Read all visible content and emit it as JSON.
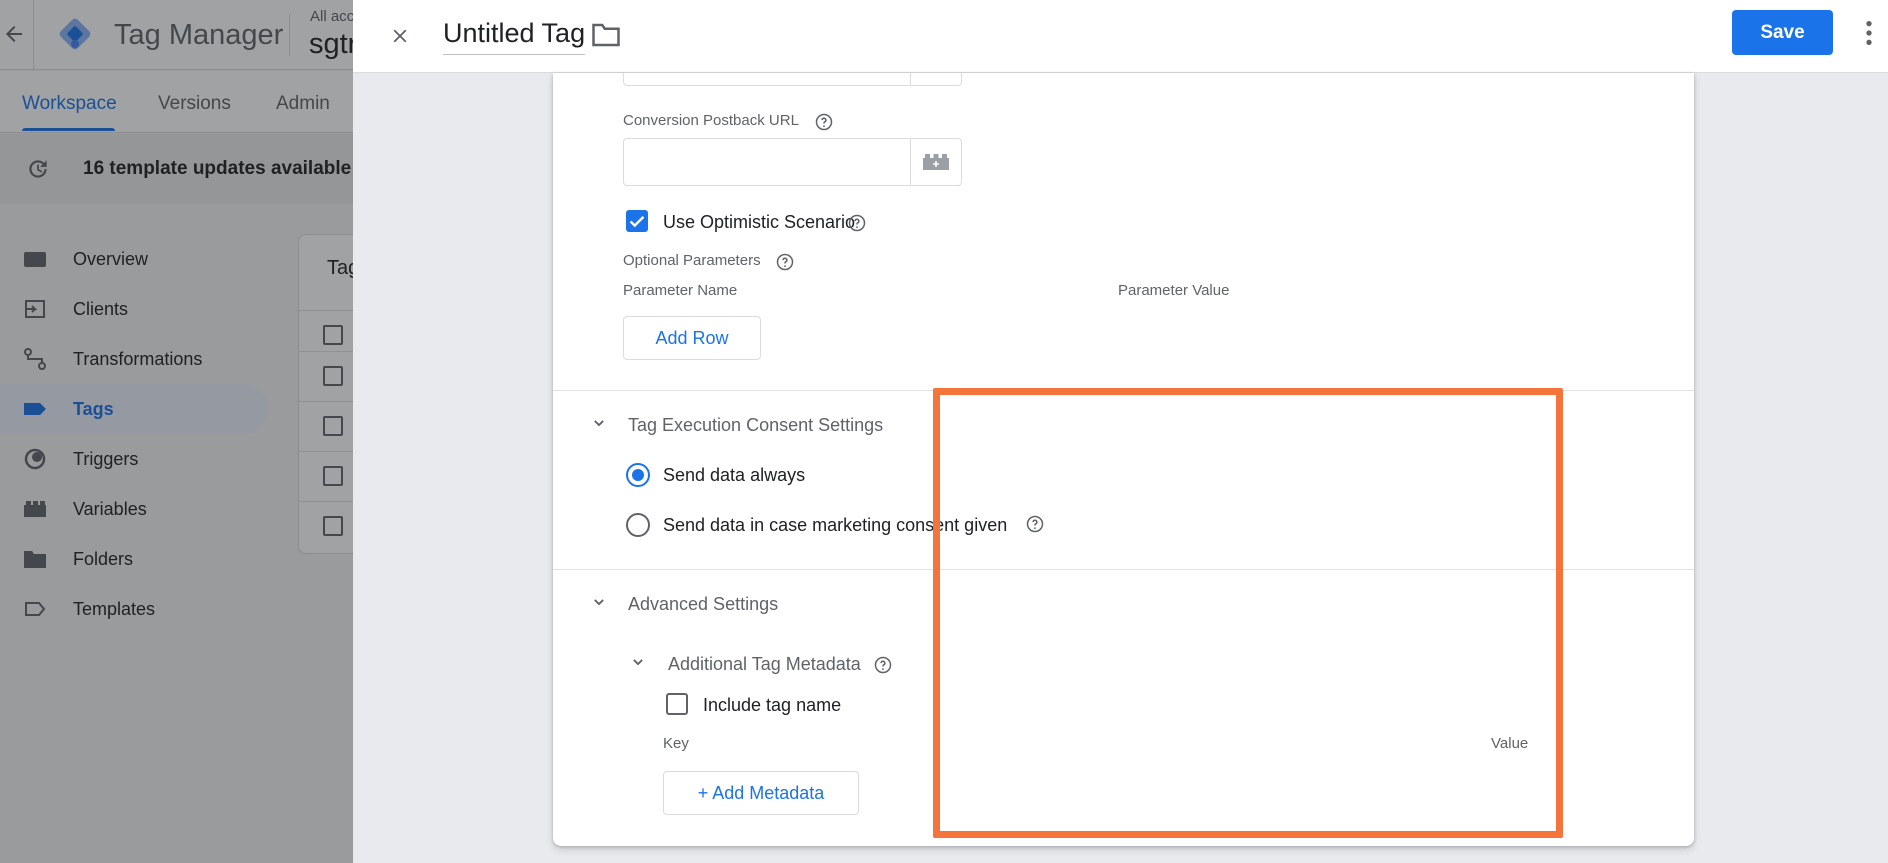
{
  "background_app": {
    "app_title": "Tag Manager",
    "account_small": "All acc",
    "account_big": "sgtr",
    "nav_tabs": [
      {
        "label": "Workspace",
        "active": true
      },
      {
        "label": "Versions",
        "active": false
      },
      {
        "label": "Admin",
        "active": false
      }
    ],
    "banner_text": "16 template updates available",
    "sidebar_items": [
      {
        "label": "Overview",
        "icon": "overview-icon",
        "active": false
      },
      {
        "label": "Clients",
        "icon": "clients-icon",
        "active": false
      },
      {
        "label": "Transformations",
        "icon": "transformations-icon",
        "active": false
      },
      {
        "label": "Tags",
        "icon": "tag-icon",
        "active": true
      },
      {
        "label": "Triggers",
        "icon": "trigger-icon",
        "active": false
      },
      {
        "label": "Variables",
        "icon": "variables-icon",
        "active": false
      },
      {
        "label": "Folders",
        "icon": "folder-icon",
        "active": false
      },
      {
        "label": "Templates",
        "icon": "template-icon",
        "active": false
      }
    ],
    "card_title": "Tag"
  },
  "panel": {
    "title": "Untitled Tag",
    "save_label": "Save",
    "fields": {
      "conversion_postback_url": {
        "label": "Conversion Postback URL",
        "value": "",
        "placeholder": ""
      },
      "use_optimistic_scenario": {
        "label": "Use Optimistic Scenario",
        "checked": true
      },
      "optional_parameters": {
        "label": "Optional Parameters",
        "column_name": "Parameter Name",
        "column_value": "Parameter Value",
        "add_row_label": "Add Row"
      }
    },
    "consent_section": {
      "title": "Tag Execution Consent Settings",
      "options": [
        {
          "label": "Send data always",
          "selected": true
        },
        {
          "label": "Send data in case marketing consent given",
          "selected": false
        }
      ]
    },
    "advanced_section": {
      "title": "Advanced Settings",
      "metadata": {
        "title": "Additional Tag Metadata",
        "include_tag_name_label": "Include tag name",
        "include_tag_name_checked": false,
        "column_key": "Key",
        "column_value": "Value",
        "add_metadata_label": "+ Add Metadata"
      }
    }
  },
  "colors": {
    "accent": "#1a73e8",
    "highlight": "#f4743b",
    "scrim": "#a9abae"
  }
}
